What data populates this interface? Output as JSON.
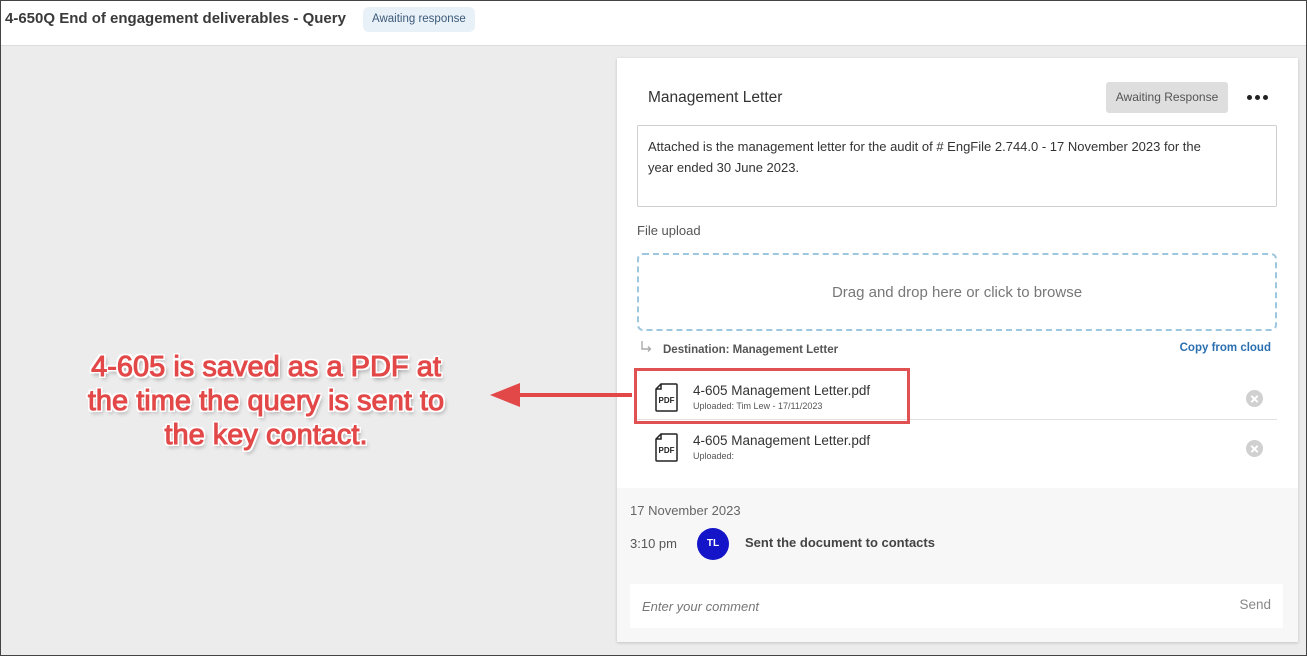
{
  "header": {
    "title": "4-650Q End of engagement deliverables - Query",
    "badge": "Awaiting response"
  },
  "card": {
    "title": "Management Letter",
    "status_button": "Awaiting Response",
    "more_icon": "ellipsis-horizontal-icon",
    "message_line1": "Attached is the management letter for the audit of # EngFile 2.744.0 - 17 November 2023 for the",
    "message_line2": "year ended 30 June 2023.",
    "upload_label": "File upload",
    "dropzone_text": "Drag and drop here or click to browse",
    "destination": "Destination: Management Letter",
    "copy_from_cloud": "Copy from cloud",
    "files": [
      {
        "name": "4-605 Management Letter.pdf",
        "meta": "Uploaded: Tim Lew - 17/11/2023",
        "icon": "pdf-file-icon"
      },
      {
        "name": "4-605 Management Letter.pdf",
        "meta": "Uploaded:",
        "icon": "pdf-file-icon"
      }
    ],
    "pdf_icon_label": "PDF"
  },
  "activity": {
    "date": "17 November 2023",
    "time": "3:10 pm",
    "avatar_initials": "TL",
    "text": "Sent the document to contacts",
    "comment_placeholder": "Enter your comment",
    "send_label": "Send"
  },
  "annotation": {
    "line1": "4-605 is saved as a PDF at",
    "line2": "the time the query is sent to",
    "line3": "the key contact.",
    "color": "#e34848"
  }
}
